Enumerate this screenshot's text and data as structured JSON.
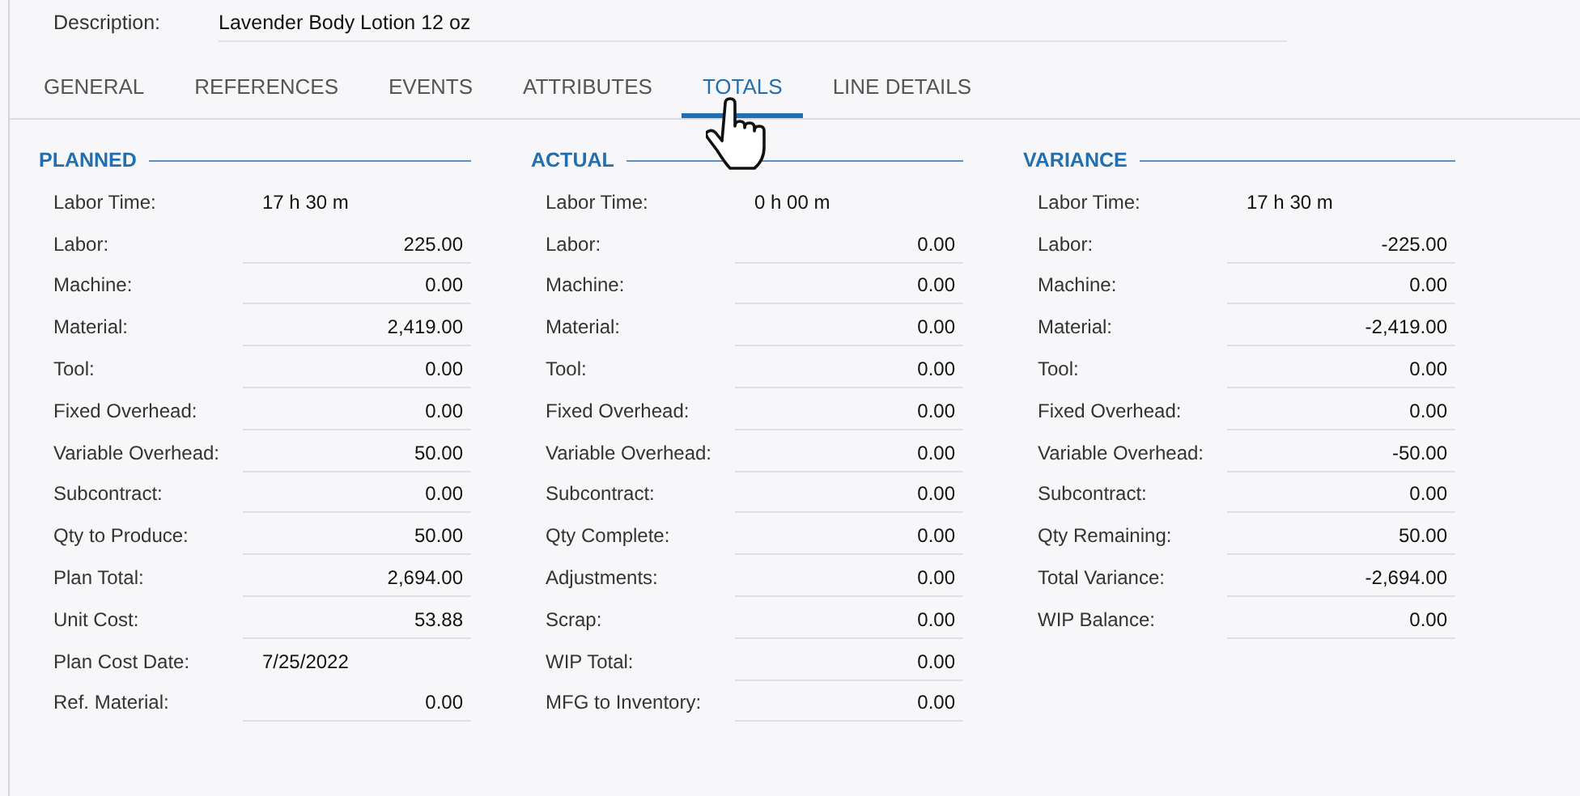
{
  "description": {
    "label": "Description:",
    "value": "Lavender Body Lotion 12 oz"
  },
  "tabs": [
    {
      "label": "GENERAL",
      "selected": false
    },
    {
      "label": "REFERENCES",
      "selected": false
    },
    {
      "label": "EVENTS",
      "selected": false
    },
    {
      "label": "ATTRIBUTES",
      "selected": false
    },
    {
      "label": "TOTALS",
      "selected": true
    },
    {
      "label": "LINE DETAILS",
      "selected": false
    }
  ],
  "sections": [
    {
      "title": "PLANNED",
      "rows": [
        {
          "label": "Labor Time:",
          "value": "17 h 30 m",
          "kind": "text"
        },
        {
          "label": "Labor:",
          "value": "225.00",
          "kind": "number"
        },
        {
          "label": "Machine:",
          "value": "0.00",
          "kind": "number"
        },
        {
          "label": "Material:",
          "value": "2,419.00",
          "kind": "number"
        },
        {
          "label": "Tool:",
          "value": "0.00",
          "kind": "number"
        },
        {
          "label": "Fixed Overhead:",
          "value": "0.00",
          "kind": "number"
        },
        {
          "label": "Variable Overhead:",
          "value": "50.00",
          "kind": "number"
        },
        {
          "label": "Subcontract:",
          "value": "0.00",
          "kind": "number"
        },
        {
          "label": "Qty to Produce:",
          "value": "50.00",
          "kind": "number"
        },
        {
          "label": "Plan Total:",
          "value": "2,694.00",
          "kind": "number"
        },
        {
          "label": "Unit Cost:",
          "value": "53.88",
          "kind": "number"
        },
        {
          "label": "Plan Cost Date:",
          "value": "7/25/2022",
          "kind": "text"
        },
        {
          "label": "Ref. Material:",
          "value": "0.00",
          "kind": "number"
        }
      ]
    },
    {
      "title": "ACTUAL",
      "rows": [
        {
          "label": "Labor Time:",
          "value": "0 h 00 m",
          "kind": "text"
        },
        {
          "label": "Labor:",
          "value": "0.00",
          "kind": "number"
        },
        {
          "label": "Machine:",
          "value": "0.00",
          "kind": "number"
        },
        {
          "label": "Material:",
          "value": "0.00",
          "kind": "number"
        },
        {
          "label": "Tool:",
          "value": "0.00",
          "kind": "number"
        },
        {
          "label": "Fixed Overhead:",
          "value": "0.00",
          "kind": "number"
        },
        {
          "label": "Variable Overhead:",
          "value": "0.00",
          "kind": "number"
        },
        {
          "label": "Subcontract:",
          "value": "0.00",
          "kind": "number"
        },
        {
          "label": "Qty Complete:",
          "value": "0.00",
          "kind": "number"
        },
        {
          "label": "Adjustments:",
          "value": "0.00",
          "kind": "number"
        },
        {
          "label": "Scrap:",
          "value": "0.00",
          "kind": "number"
        },
        {
          "label": "WIP Total:",
          "value": "0.00",
          "kind": "number"
        },
        {
          "label": "MFG to Inventory:",
          "value": "0.00",
          "kind": "number"
        }
      ]
    },
    {
      "title": "VARIANCE",
      "rows": [
        {
          "label": "Labor Time:",
          "value": "17 h 30 m",
          "kind": "text"
        },
        {
          "label": "Labor:",
          "value": "-225.00",
          "kind": "number"
        },
        {
          "label": "Machine:",
          "value": "0.00",
          "kind": "number"
        },
        {
          "label": "Material:",
          "value": "-2,419.00",
          "kind": "number"
        },
        {
          "label": "Tool:",
          "value": "0.00",
          "kind": "number"
        },
        {
          "label": "Fixed Overhead:",
          "value": "0.00",
          "kind": "number"
        },
        {
          "label": "Variable Overhead:",
          "value": "-50.00",
          "kind": "number"
        },
        {
          "label": "Subcontract:",
          "value": "0.00",
          "kind": "number"
        },
        {
          "label": "Qty Remaining:",
          "value": "50.00",
          "kind": "number"
        },
        {
          "label": "Total Variance:",
          "value": "-2,694.00",
          "kind": "number"
        },
        {
          "label": "WIP Balance:",
          "value": "0.00",
          "kind": "number"
        }
      ]
    }
  ]
}
